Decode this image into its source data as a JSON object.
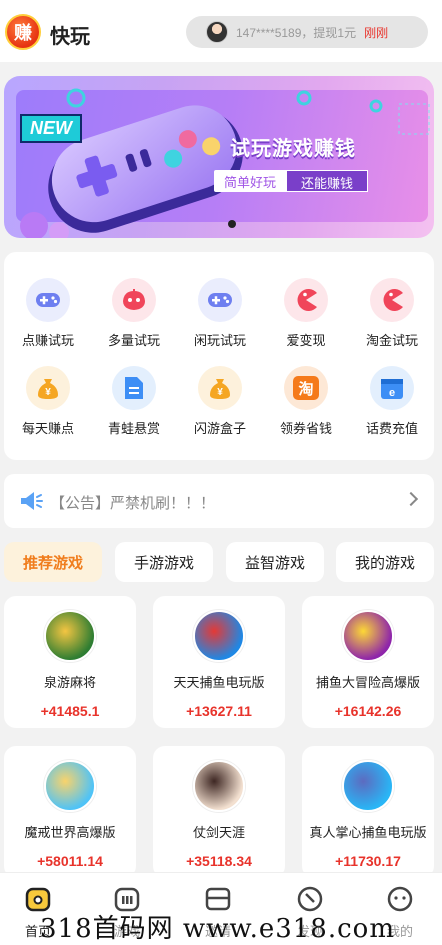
{
  "header": {
    "logo_char": "赚",
    "title": "快玩",
    "notice": {
      "text": "147****5189，提现1元",
      "time": "刚刚"
    }
  },
  "banner": {
    "new_tag": "NEW",
    "title": "试玩游戏赚钱",
    "sub_left": "简单好玩",
    "sub_right": "还能赚钱"
  },
  "grid": {
    "items": [
      {
        "label": "点赚试玩",
        "icon": "gamepad-icon",
        "color": "#6e7ff0",
        "bg": "#eaedfd"
      },
      {
        "label": "多量试玩",
        "icon": "controller-icon",
        "color": "#f0455a",
        "bg": "#fde6ea"
      },
      {
        "label": "闲玩试玩",
        "icon": "gamepad-icon",
        "color": "#6e7ff0",
        "bg": "#eaedfd"
      },
      {
        "label": "爱变现",
        "icon": "pacman-icon",
        "color": "#f0455a",
        "bg": "#fde6ea"
      },
      {
        "label": "淘金试玩",
        "icon": "pacman-icon",
        "color": "#f0455a",
        "bg": "#fde6ea"
      },
      {
        "label": "每天赚点",
        "icon": "money-bag-icon",
        "color": "#f5a623",
        "bg": "#fdf1dc"
      },
      {
        "label": "青蛙悬赏",
        "icon": "document-icon",
        "color": "#3d8ef5",
        "bg": "#e3effd"
      },
      {
        "label": "闪游盒子",
        "icon": "money-bag-icon",
        "color": "#f5a623",
        "bg": "#fdf1dc"
      },
      {
        "label": "领券省钱",
        "icon": "taobao-icon",
        "color": "#f57a1a",
        "bg": "#fde8d6"
      },
      {
        "label": "话费充值",
        "icon": "phone-card-icon",
        "color": "#3d8ef5",
        "bg": "#e3effd"
      }
    ]
  },
  "announcement": {
    "text": "【公告】严禁机刷！！！"
  },
  "tabs": [
    {
      "label": "推荐游戏",
      "active": true
    },
    {
      "label": "手游游戏",
      "active": false
    },
    {
      "label": "益智游戏",
      "active": false
    },
    {
      "label": "我的游戏",
      "active": false
    }
  ],
  "games": [
    {
      "name": "泉游麻将",
      "reward": "+41485.1",
      "colors": [
        "#2e7d32",
        "#f4c542"
      ]
    },
    {
      "name": "天天捕鱼电玩版",
      "reward": "+13627.11",
      "colors": [
        "#1e88e5",
        "#e53935"
      ]
    },
    {
      "name": "捕鱼大冒险高爆版",
      "reward": "+16142.26",
      "colors": [
        "#8e24aa",
        "#fdd835"
      ]
    },
    {
      "name": "魔戒世界高爆版",
      "reward": "+58011.14",
      "colors": [
        "#4fc3f7",
        "#f9d36b"
      ]
    },
    {
      "name": "仗剑天涯",
      "reward": "+35118.34",
      "colors": [
        "#f3e0d0",
        "#3e2723"
      ]
    },
    {
      "name": "真人掌心捕鱼电玩版",
      "reward": "+11730.17",
      "colors": [
        "#29b6f6",
        "#5c6bc0"
      ]
    }
  ],
  "bottom_nav": [
    {
      "label": "首页",
      "icon": "home-icon",
      "active": true
    },
    {
      "label": "游戏",
      "icon": "game-icon",
      "active": false
    },
    {
      "label": "邀请",
      "icon": "invite-icon",
      "active": false
    },
    {
      "label": "发现",
      "icon": "discover-icon",
      "active": false
    },
    {
      "label": "我的",
      "icon": "profile-icon",
      "active": false
    }
  ],
  "watermark": "318首码网 www.e318.com"
}
